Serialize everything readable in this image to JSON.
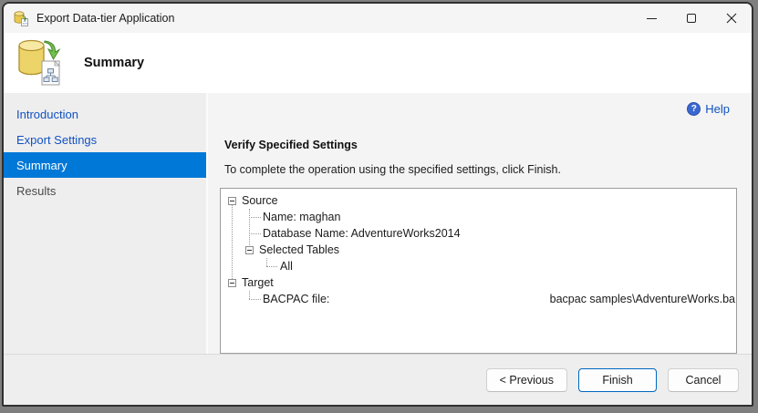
{
  "window": {
    "title": "Export Data-tier Application"
  },
  "header": {
    "title": "Summary"
  },
  "sidebar": {
    "items": [
      {
        "label": "Introduction",
        "state": "link"
      },
      {
        "label": "Export Settings",
        "state": "link"
      },
      {
        "label": "Summary",
        "state": "selected"
      },
      {
        "label": "Results",
        "state": "disabled"
      }
    ]
  },
  "main": {
    "help_label": "Help",
    "heading": "Verify Specified Settings",
    "description": "To complete the operation using the specified settings, click Finish.",
    "tree": [
      {
        "label": "Source",
        "level": 0,
        "expanded": true
      },
      {
        "label": "Name: maghan",
        "level": 1
      },
      {
        "label": "Database Name: AdventureWorks2014",
        "level": 1
      },
      {
        "label": "Selected Tables",
        "level": 1,
        "expanded": true
      },
      {
        "label": "All",
        "level": 2
      },
      {
        "label": "Target",
        "level": 0,
        "expanded": true
      },
      {
        "label": "BACPAC file:",
        "level": 1,
        "value": "bacpac samples\\AdventureWorks.ba"
      }
    ]
  },
  "footer": {
    "buttons": [
      {
        "label": "< Previous",
        "role": "previous"
      },
      {
        "label": "Finish",
        "role": "finish",
        "default": true
      },
      {
        "label": "Cancel",
        "role": "cancel"
      }
    ]
  },
  "colors": {
    "accent_selected": "#0078d7",
    "nav_link_blue": "#1152c1",
    "help_blue": "#3b68d0",
    "finish_border": "#0067c0",
    "sidebar_bg": "#eeeeee",
    "main_bg": "#f4f4f4"
  }
}
